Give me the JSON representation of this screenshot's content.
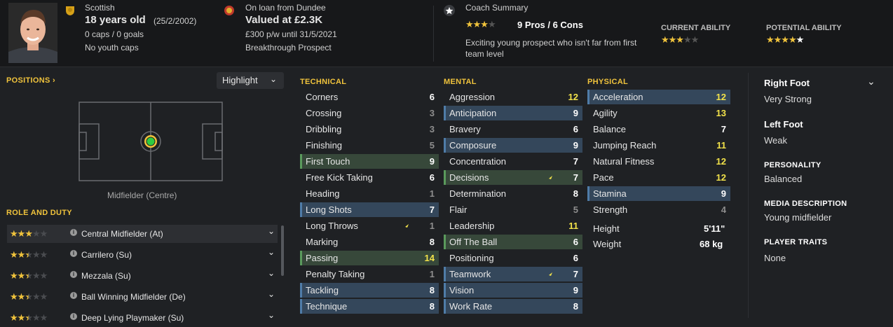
{
  "header": {
    "nationality": "Scottish",
    "age": "18 years old",
    "dob": "(25/2/2002)",
    "caps_goals": "0 caps / 0 goals",
    "youth_caps": "No youth caps",
    "loan_text": "On loan from Dundee",
    "value": "Valued at £2.3K",
    "wage": "£300 p/w until 31/5/2021",
    "status": "Breakthrough Prospect",
    "coach_summary_title": "Coach Summary",
    "pros_cons": "9 Pros / 6 Cons",
    "coach_stars": 3,
    "coach_text": "Exciting young prospect who isn't far from first team level",
    "current_ability_label": "CURRENT ABILITY",
    "current_ability_stars": 3,
    "potential_ability_label": "POTENTIAL ABILITY",
    "potential_ability_stars": 4.5
  },
  "positions": {
    "title": "POSITIONS",
    "highlight_label": "Highlight",
    "position_name": "Midfielder (Centre)"
  },
  "roles": {
    "title": "ROLE AND DUTY",
    "items": [
      {
        "name": "Central Midfielder (At)",
        "stars": 3
      },
      {
        "name": "Carrilero (Su)",
        "stars": 2.5
      },
      {
        "name": "Mezzala (Su)",
        "stars": 2.5
      },
      {
        "name": "Ball Winning Midfielder (De)",
        "stars": 2.5
      },
      {
        "name": "Deep Lying Playmaker (Su)",
        "stars": 2.5
      }
    ]
  },
  "technical": {
    "title": "TECHNICAL",
    "attrs": [
      {
        "name": "Corners",
        "value": "6",
        "hl": "",
        "color": "white"
      },
      {
        "name": "Crossing",
        "value": "3",
        "hl": "",
        "color": "grey"
      },
      {
        "name": "Dribbling",
        "value": "3",
        "hl": "",
        "color": "grey"
      },
      {
        "name": "Finishing",
        "value": "5",
        "hl": "",
        "color": "grey"
      },
      {
        "name": "First Touch",
        "value": "9",
        "hl": "green",
        "color": "white"
      },
      {
        "name": "Free Kick Taking",
        "value": "6",
        "hl": "",
        "color": "white"
      },
      {
        "name": "Heading",
        "value": "1",
        "hl": "",
        "color": "grey"
      },
      {
        "name": "Long Shots",
        "value": "7",
        "hl": "blue",
        "color": "white"
      },
      {
        "name": "Long Throws",
        "value": "1",
        "hl": "",
        "color": "grey",
        "arrow": true
      },
      {
        "name": "Marking",
        "value": "8",
        "hl": "",
        "color": "white"
      },
      {
        "name": "Passing",
        "value": "14",
        "hl": "green",
        "color": "yellow"
      },
      {
        "name": "Penalty Taking",
        "value": "1",
        "hl": "",
        "color": "grey"
      },
      {
        "name": "Tackling",
        "value": "8",
        "hl": "blue",
        "color": "white"
      },
      {
        "name": "Technique",
        "value": "8",
        "hl": "blue",
        "color": "white"
      }
    ]
  },
  "mental": {
    "title": "MENTAL",
    "attrs": [
      {
        "name": "Aggression",
        "value": "12",
        "hl": "",
        "color": "yellow"
      },
      {
        "name": "Anticipation",
        "value": "9",
        "hl": "blue",
        "color": "white"
      },
      {
        "name": "Bravery",
        "value": "6",
        "hl": "",
        "color": "white"
      },
      {
        "name": "Composure",
        "value": "9",
        "hl": "blue",
        "color": "white"
      },
      {
        "name": "Concentration",
        "value": "7",
        "hl": "",
        "color": "white"
      },
      {
        "name": "Decisions",
        "value": "7",
        "hl": "green",
        "color": "white",
        "arrow": true
      },
      {
        "name": "Determination",
        "value": "8",
        "hl": "",
        "color": "white"
      },
      {
        "name": "Flair",
        "value": "5",
        "hl": "",
        "color": "grey"
      },
      {
        "name": "Leadership",
        "value": "11",
        "hl": "",
        "color": "yellow"
      },
      {
        "name": "Off The Ball",
        "value": "6",
        "hl": "green",
        "color": "white"
      },
      {
        "name": "Positioning",
        "value": "6",
        "hl": "",
        "color": "white"
      },
      {
        "name": "Teamwork",
        "value": "7",
        "hl": "blue",
        "color": "white",
        "arrow": true
      },
      {
        "name": "Vision",
        "value": "9",
        "hl": "blue",
        "color": "white"
      },
      {
        "name": "Work Rate",
        "value": "8",
        "hl": "blue",
        "color": "white"
      }
    ]
  },
  "physical": {
    "title": "PHYSICAL",
    "attrs": [
      {
        "name": "Acceleration",
        "value": "12",
        "hl": "blue",
        "color": "yellow"
      },
      {
        "name": "Agility",
        "value": "13",
        "hl": "",
        "color": "yellow"
      },
      {
        "name": "Balance",
        "value": "7",
        "hl": "",
        "color": "white"
      },
      {
        "name": "Jumping Reach",
        "value": "11",
        "hl": "",
        "color": "yellow"
      },
      {
        "name": "Natural Fitness",
        "value": "12",
        "hl": "",
        "color": "yellow"
      },
      {
        "name": "Pace",
        "value": "12",
        "hl": "",
        "color": "yellow"
      },
      {
        "name": "Stamina",
        "value": "9",
        "hl": "blue",
        "color": "white"
      },
      {
        "name": "Strength",
        "value": "4",
        "hl": "",
        "color": "grey"
      }
    ],
    "height_label": "Height",
    "height_value": "5'11\"",
    "weight_label": "Weight",
    "weight_value": "68 kg"
  },
  "profile": {
    "right_foot_label": "Right Foot",
    "right_foot_value": "Very Strong",
    "left_foot_label": "Left Foot",
    "left_foot_value": "Weak",
    "personality_label": "PERSONALITY",
    "personality_value": "Balanced",
    "media_label": "MEDIA DESCRIPTION",
    "media_value": "Young midfielder",
    "traits_label": "PLAYER TRAITS",
    "traits_value": "None"
  },
  "colors": {
    "accent": "#f0c33c",
    "good": "#f2e24a",
    "key_attr_blue": "#34475b",
    "pref_attr_green": "#37483a"
  }
}
